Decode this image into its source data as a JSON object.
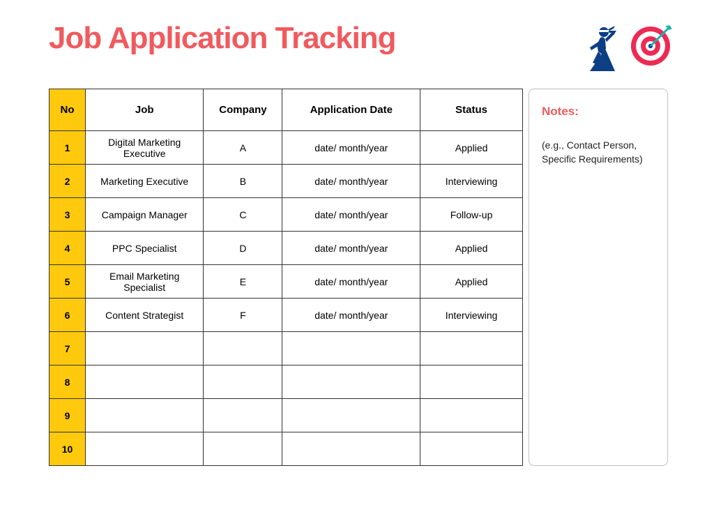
{
  "title": "Job Application Tracking",
  "table": {
    "headers": {
      "no": "No",
      "job": "Job",
      "company": "Company",
      "date": "Application Date",
      "status": "Status"
    },
    "rows": [
      {
        "no": "1",
        "job": "Digital Marketing Executive",
        "company": "A",
        "date": "date/ month/year",
        "status": "Applied"
      },
      {
        "no": "2",
        "job": "Marketing Executive",
        "company": "B",
        "date": "date/ month/year",
        "status": "Interviewing"
      },
      {
        "no": "3",
        "job": "Campaign Manager",
        "company": "C",
        "date": "date/ month/year",
        "status": "Follow-up"
      },
      {
        "no": "4",
        "job": "PPC Specialist",
        "company": "D",
        "date": "date/ month/year",
        "status": "Applied"
      },
      {
        "no": "5",
        "job": "Email Marketing Specialist",
        "company": "E",
        "date": "date/ month/year",
        "status": "Applied"
      },
      {
        "no": "6",
        "job": "Content Strategist",
        "company": "F",
        "date": "date/ month/year",
        "status": "Interviewing"
      },
      {
        "no": "7",
        "job": "",
        "company": "",
        "date": "",
        "status": ""
      },
      {
        "no": "8",
        "job": "",
        "company": "",
        "date": "",
        "status": ""
      },
      {
        "no": "9",
        "job": "",
        "company": "",
        "date": "",
        "status": ""
      },
      {
        "no": "10",
        "job": "",
        "company": "",
        "date": "",
        "status": ""
      }
    ]
  },
  "notes": {
    "title": "Notes:",
    "body": "(e.g., Contact Person, Specific Requirements)"
  }
}
